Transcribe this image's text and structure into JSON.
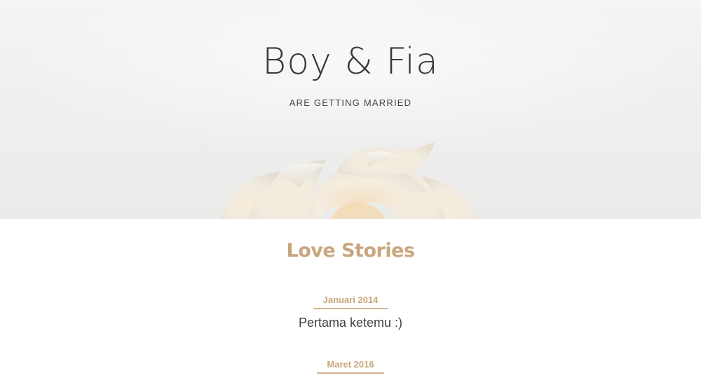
{
  "hero": {
    "title": "Boy & Fia",
    "subtitle": "ARE GETTING MARRIED",
    "image": "white-rose"
  },
  "love_stories": {
    "title": "Love Stories",
    "items": [
      {
        "date": "Januari 2014",
        "text": "Pertama ketemu :)"
      },
      {
        "date": "Maret 2016",
        "text": ""
      }
    ]
  },
  "colors": {
    "accent": "#c8a67e",
    "text": "#3e3e3e",
    "hero_bg": "#efefef"
  }
}
